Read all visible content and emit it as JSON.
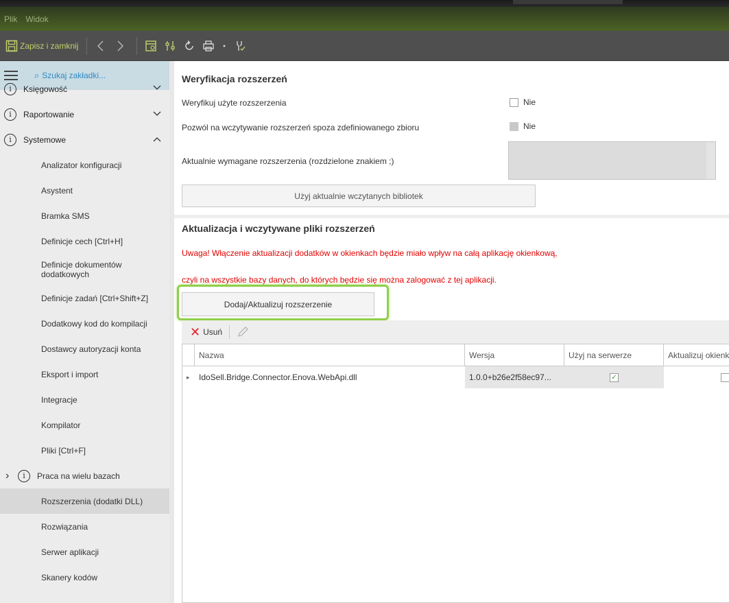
{
  "menubar": {
    "items": [
      "Plik",
      "Widok"
    ]
  },
  "toolbar": {
    "save_label": "Zapisz i zamknij",
    "icons": [
      "save-icon",
      "back-icon",
      "forward-icon",
      "window-icon",
      "settings-icon",
      "refresh-icon",
      "print-icon",
      "dropdown-icon",
      "wrench-icon"
    ]
  },
  "sidebar": {
    "search_placeholder": "Szukaj zakładki...",
    "groups": [
      {
        "label": "Księgowość",
        "expanded": false
      },
      {
        "label": "Raportowanie",
        "expanded": false
      },
      {
        "label": "Systemowe",
        "expanded": true
      }
    ],
    "items": [
      "Analizator konfiguracji",
      "Asystent",
      "Bramka SMS",
      "Definicje cech [Ctrl+H]",
      "Definicje dokumentów dodatkowych",
      "Definicje zadań [Ctrl+Shift+Z]",
      "Dodatkowy kod do kompilacji",
      "Dostawcy autoryzacji konta",
      "Eksport i import",
      "Integracje",
      "Kompilator",
      "Pliki [Ctrl+F]"
    ],
    "subgroup": "Praca na wielu bazach",
    "items2": [
      "Rozszerzenia (dodatki DLL)",
      "Rozwiązania",
      "Serwer aplikacji",
      "Skanery kodów"
    ],
    "active_item": "Rozszerzenia (dodatki DLL)"
  },
  "verification": {
    "title": "Weryfikacja rozszerzeń",
    "verify_label": "Weryfikuj użyte rozszerzenia",
    "verify_value": "Nie",
    "allow_label": "Pozwól na wczytywanie rozszerzeń spoza zdefiniowanego zbioru",
    "allow_value": "Nie",
    "required_label": "Aktualnie wymagane rozszerzenia (rozdzielone znakiem ;)",
    "use_loaded_button": "Użyj aktualnie wczytanych bibliotek"
  },
  "update": {
    "title": "Aktualizacja i wczytywane pliki rozszerzeń",
    "warning_line1": "Uwaga! Włączenie aktualizacji dodatków w okienkach będzie miało wpływ na całą aplikację okienkową,",
    "warning_line2": "czyli na wszystkie bazy danych, do których będzie się można zalogować z tej aplikacji.",
    "add_button": "Dodaj/Aktualizuj rozszerzenie",
    "delete_label": "Usuń"
  },
  "grid": {
    "columns": [
      "Nazwa",
      "Wersja",
      "Użyj na serwerze",
      "Aktualizuj okienka"
    ],
    "rows": [
      {
        "name": "IdoSell.Bridge.Connector.Enova.WebApi.dll",
        "version": "1.0.0+b26e2f58ec97...",
        "use_on_server": true,
        "update_windows": false
      }
    ]
  },
  "colors": {
    "accent_green": "#8fcf4a",
    "warning_red": "#e00000",
    "search_blue": "#2e8cc4"
  }
}
